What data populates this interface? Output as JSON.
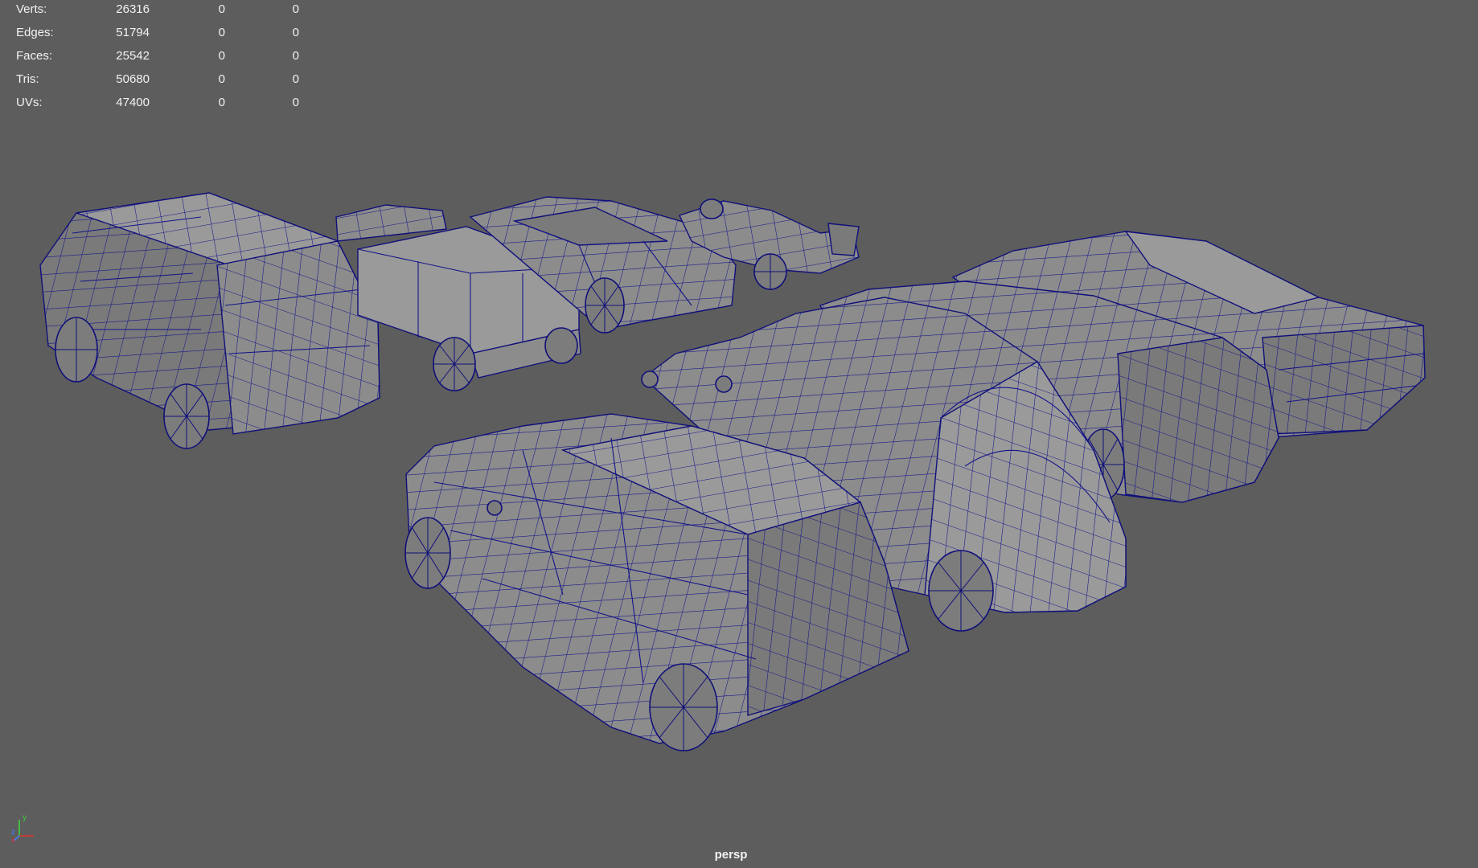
{
  "hud": {
    "rows": [
      {
        "label": "Verts:",
        "values": [
          "26316",
          "0",
          "0"
        ]
      },
      {
        "label": "Edges:",
        "values": [
          "51794",
          "0",
          "0"
        ]
      },
      {
        "label": "Faces:",
        "values": [
          "25542",
          "0",
          "0"
        ]
      },
      {
        "label": "Tris:",
        "values": [
          "50680",
          "0",
          "0"
        ]
      },
      {
        "label": "UVs:",
        "values": [
          "47400",
          "0",
          "0"
        ]
      }
    ]
  },
  "viewport": {
    "camera": "persp",
    "background_color": "#5d5d5d",
    "wireframe_color": "#10107a",
    "shaded_color": "#8c8c8c"
  },
  "axis_gizmo": {
    "labels": [
      "y",
      "z",
      "x"
    ],
    "colors": {
      "x": "#e03030",
      "y": "#40d040",
      "z": "#4080ff"
    }
  }
}
